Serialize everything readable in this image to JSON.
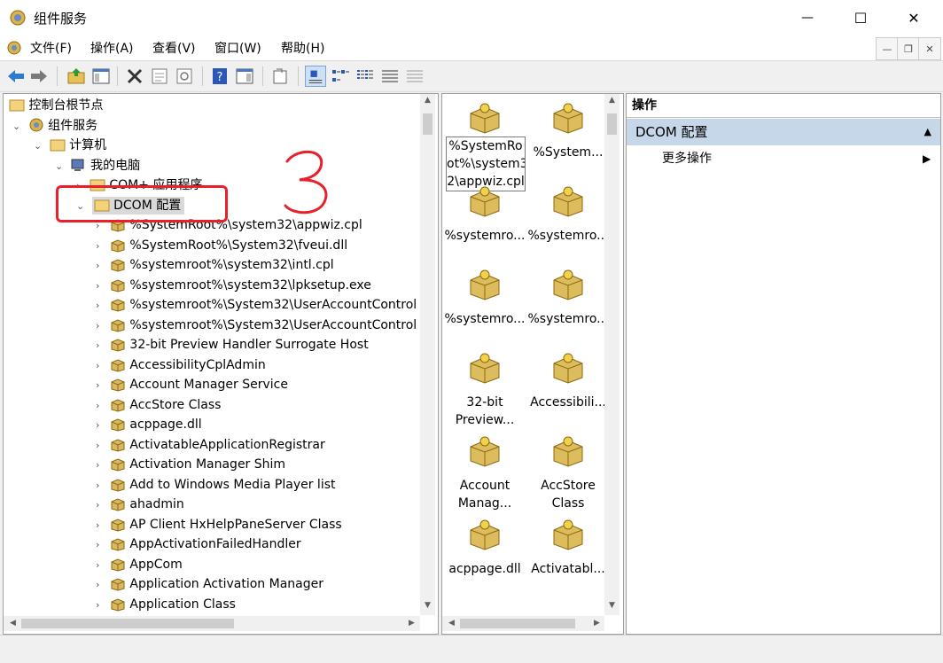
{
  "window": {
    "title": "组件服务",
    "minimize_glyph": "—",
    "maximize_glyph": "☐",
    "close_glyph": "✕"
  },
  "menubar": {
    "items": [
      "文件(F)",
      "操作(A)",
      "查看(V)",
      "窗口(W)",
      "帮助(H)"
    ],
    "mdi_min": "—",
    "mdi_restore": "❐",
    "mdi_close": "✕"
  },
  "toolbar": {
    "icons": [
      "back-arrow-icon",
      "forward-arrow-icon",
      "up-folder-icon",
      "show-hide-tree-icon",
      "delete-icon",
      "properties-icon",
      "refresh-icon",
      "help-icon",
      "show-hide-action-pane-icon",
      "export-list-icon",
      "large-icons-view-icon",
      "small-icons-view-icon",
      "list-view-icon",
      "detail-view-icon",
      "toolbar-extra-icon"
    ]
  },
  "tree": {
    "root": "控制台根节点",
    "component_services": "组件服务",
    "computers": "计算机",
    "my_computer": "我的电脑",
    "com_apps": "COM+ 应用程序",
    "dcom": "DCOM 配置",
    "dcom_items": [
      "%SystemRoot%\\system32\\appwiz.cpl",
      "%SystemRoot%\\System32\\fveui.dll",
      "%systemroot%\\system32\\intl.cpl",
      "%systemroot%\\system32\\lpksetup.exe",
      "%systemroot%\\System32\\UserAccountControl",
      "%systemroot%\\System32\\UserAccountControl",
      "32-bit Preview Handler Surrogate Host",
      "AccessibilityCplAdmin",
      "Account Manager Service",
      "AccStore Class",
      "acppage.dll",
      "ActivatableApplicationRegistrar",
      "Activation Manager Shim",
      "Add to Windows Media Player list",
      "ahadmin",
      "AP Client HxHelpPaneServer Class",
      "AppActivationFailedHandler",
      "AppCom",
      "Application Activation Manager",
      "Application Class"
    ]
  },
  "annotation": {
    "text": "3",
    "color": "#e8202a"
  },
  "icon_view": {
    "items": [
      {
        "line1": "%SystemRo",
        "line2": "ot%\\system3",
        "line3": "2\\appwiz.cpl"
      },
      {
        "line1": "%System...",
        "line2": "",
        "line3": ""
      },
      {
        "line1": "%systemro...",
        "line2": "",
        "line3": ""
      },
      {
        "line1": "%systemro...",
        "line2": "",
        "line3": ""
      },
      {
        "line1": "%systemro...",
        "line2": "",
        "line3": ""
      },
      {
        "line1": "%systemro...",
        "line2": "",
        "line3": ""
      },
      {
        "line1": "32-bit",
        "line2": "Preview...",
        "line3": ""
      },
      {
        "line1": "Accessibili...",
        "line2": "",
        "line3": ""
      },
      {
        "line1": "Account",
        "line2": "Manag...",
        "line3": ""
      },
      {
        "line1": "AccStore",
        "line2": "Class",
        "line3": ""
      },
      {
        "line1": "acppage.dll",
        "line2": "",
        "line3": ""
      },
      {
        "line1": "Activatabl...",
        "line2": "",
        "line3": ""
      }
    ]
  },
  "actions": {
    "header": "操作",
    "section": "DCOM 配置",
    "more": "更多操作",
    "section_bg": "#c6d7ea"
  }
}
